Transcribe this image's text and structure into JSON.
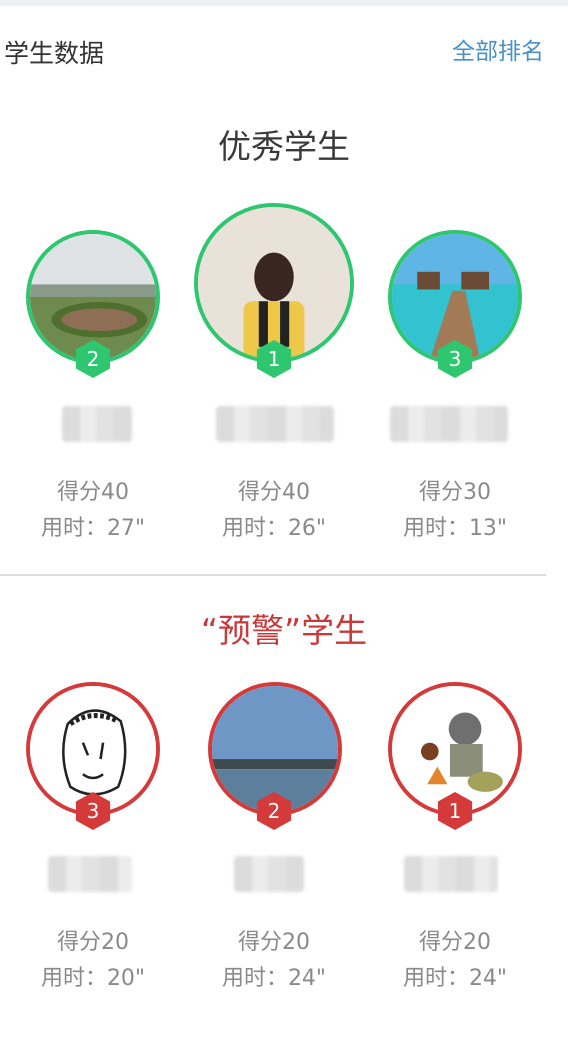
{
  "header": {
    "title": "学生数据",
    "all_rank_label": "全部排名"
  },
  "excellent": {
    "title": "优秀学生",
    "students": [
      {
        "rank": "2",
        "score": "得分40",
        "time": "用时：27\""
      },
      {
        "rank": "1",
        "score": "得分40",
        "time": "用时：26\""
      },
      {
        "rank": "3",
        "score": "得分30",
        "time": "用时：13\""
      }
    ]
  },
  "warning": {
    "title": "“预警”学生",
    "students": [
      {
        "rank": "3",
        "score": "得分20",
        "time": "用时：20\""
      },
      {
        "rank": "2",
        "name": "",
        "score": "得分20",
        "time": "用时：24\""
      },
      {
        "rank": "1",
        "score": "得分20",
        "time": "用时：24\""
      }
    ]
  },
  "colors": {
    "green": "#2ec66e",
    "red": "#d43a3a",
    "link": "#4a90c8"
  }
}
